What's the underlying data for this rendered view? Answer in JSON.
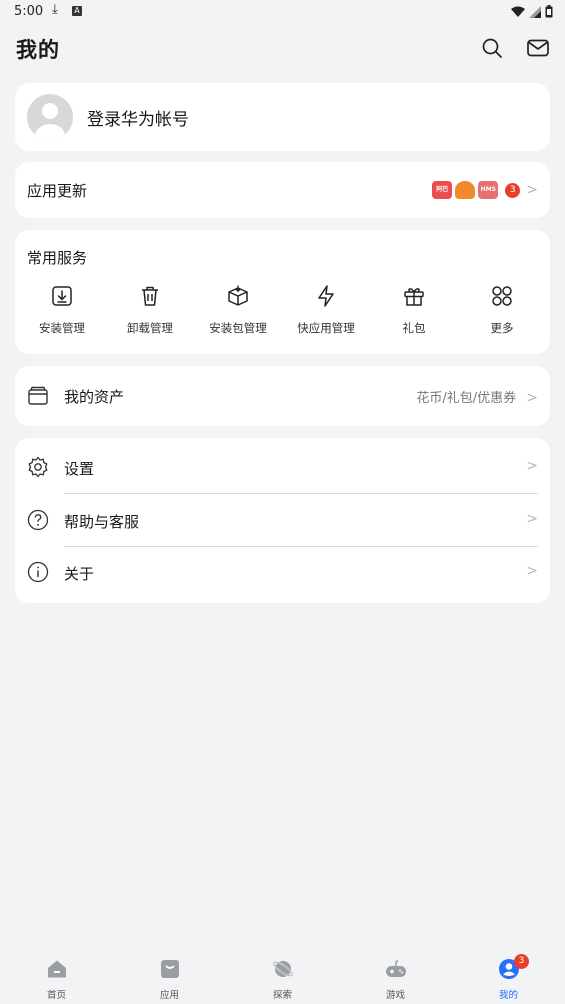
{
  "status_bar": {
    "time": "5:00",
    "download_glyph": "⤓",
    "notif_glyph": "A"
  },
  "header": {
    "title": "我的",
    "search_icon": "search-icon",
    "mail_icon": "mail-icon"
  },
  "login": {
    "text": "登录华为帐号"
  },
  "update": {
    "label": "应用更新",
    "apps": [
      {
        "icon": "app-icon-1",
        "color": "#e94d4d",
        "text": "阿巴"
      },
      {
        "icon": "app-icon-2",
        "color": "#f08a2a",
        "text": ""
      },
      {
        "icon": "app-icon-hms",
        "color": "#e86f6f",
        "text": "HMS"
      }
    ],
    "badge": "3"
  },
  "services": {
    "title": "常用服务",
    "items": [
      {
        "label": "安装管理",
        "icon": "install-icon"
      },
      {
        "label": "卸载管理",
        "icon": "uninstall-icon"
      },
      {
        "label": "安装包管理",
        "icon": "package-icon"
      },
      {
        "label": "快应用管理",
        "icon": "quick-app-icon"
      },
      {
        "label": "礼包",
        "icon": "gift-icon"
      },
      {
        "label": "更多",
        "icon": "more-icon"
      }
    ]
  },
  "assets": {
    "label": "我的资产",
    "detail": "花币/礼包/优惠券"
  },
  "settings": {
    "items": [
      {
        "label": "设置",
        "icon": "gear-icon"
      },
      {
        "label": "帮助与客服",
        "icon": "help-icon"
      },
      {
        "label": "关于",
        "icon": "info-icon"
      }
    ]
  },
  "tabbar": {
    "items": [
      {
        "label": "首页",
        "icon": "home-icon"
      },
      {
        "label": "应用",
        "icon": "apps-icon"
      },
      {
        "label": "探索",
        "icon": "explore-icon"
      },
      {
        "label": "游戏",
        "icon": "game-icon"
      },
      {
        "label": "我的",
        "icon": "me-icon"
      }
    ],
    "active": "我的",
    "me_badge": "3"
  },
  "colors": {
    "accent": "#256fff",
    "badge": "#e84026",
    "background": "#f1f3f5"
  }
}
